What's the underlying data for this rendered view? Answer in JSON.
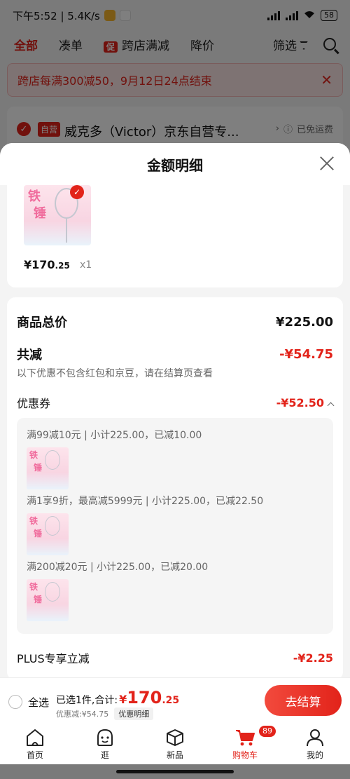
{
  "status_bar": {
    "time_speed": "下午5:52 | 5.4K/s",
    "battery": "58"
  },
  "filter_bar": {
    "tabs": [
      "全部",
      "凑单",
      "跨店满减",
      "降价"
    ],
    "promo_tag": "促",
    "filter": "筛选"
  },
  "notice": {
    "text": "跨店每满300减50，9月12日24点结束"
  },
  "shop": {
    "tag": "自营",
    "name": "威克多（Victor）京东自营专...",
    "shipping": "已免运费"
  },
  "sheet": {
    "title": "金额明细"
  },
  "product": {
    "price_main": "¥170",
    "price_dec": ".25",
    "qty": "x1",
    "img_char_1": "铁",
    "img_char_2": "锤"
  },
  "details": {
    "total_label": "商品总价",
    "total_value": "¥225.00",
    "reduce_label": "共减",
    "reduce_value": "-¥54.75",
    "reduce_note": "以下优惠不包含红包和京豆，请在结算页查看",
    "coupon_label": "优惠券",
    "coupon_value": "-¥52.50",
    "coupons": [
      "满99减10元 | 小计225.00，已减10.00",
      "满1享9折，最高减5999元 | 小计225.00，已减22.50",
      "满200减20元 | 小计225.00，已减20.00"
    ],
    "plus_label": "PLUS专享立减",
    "plus_value": "-¥2.25"
  },
  "checkout": {
    "select_all": "全选",
    "selected_text": "已选1件,合计:",
    "currency": "¥",
    "total_main": "170",
    "total_dec": ".25",
    "discount_text": "优惠减:¥54.75",
    "detail_pill": "优惠明细",
    "button": "去结算"
  },
  "tabbar": {
    "items": [
      "首页",
      "逛",
      "新品",
      "购物车",
      "我的"
    ],
    "cart_badge": "89"
  },
  "colors": {
    "accent": "#e2231a"
  }
}
